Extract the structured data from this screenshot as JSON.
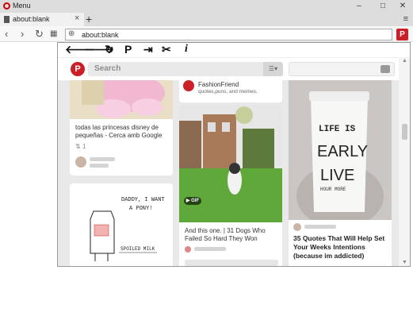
{
  "browser": {
    "menu_label": "Menu",
    "tab_title": "about:blank",
    "url": "about:blank",
    "new_tab_glyph": "+",
    "tab_close_glyph": "×"
  },
  "toolbar": {
    "back": "🡐",
    "forward": "🡒",
    "reload": "↻",
    "pinterest": "P",
    "logout": "⇥",
    "tools": "✂",
    "info": "i"
  },
  "pinterest": {
    "logo_glyph": "P",
    "search_placeholder": "Search",
    "colors": {
      "brand": "#cb2027",
      "feed_bg": "#e9e9e9"
    }
  },
  "pins": {
    "pin1": {
      "caption": "todas las princesas disney de pequeñas - Cerca amb Google",
      "repins": "1"
    },
    "pin2": {
      "sketch_text_1": "DADDY, I WANT",
      "sketch_text_2": "A PONY!",
      "sketch_text_3": "SPOILED MILK"
    },
    "pin3": {
      "board_name": "FashionFriend",
      "board_desc": "quotes,puns, and memes.",
      "gif_badge": "GIF",
      "caption": "And this one. | 31 Dogs Who Failed So Hard They Won"
    },
    "pin4": {
      "cup_text_1": "LIFE IS",
      "cup_text_2": "EARLY",
      "cup_text_3": "LIVE",
      "cup_text_4": "HOUR MORE",
      "title": "35 Quotes That Will Help Set Your Weeks Intentions (because im addicted)"
    }
  },
  "floating": {
    "add": "+",
    "help": "?"
  }
}
